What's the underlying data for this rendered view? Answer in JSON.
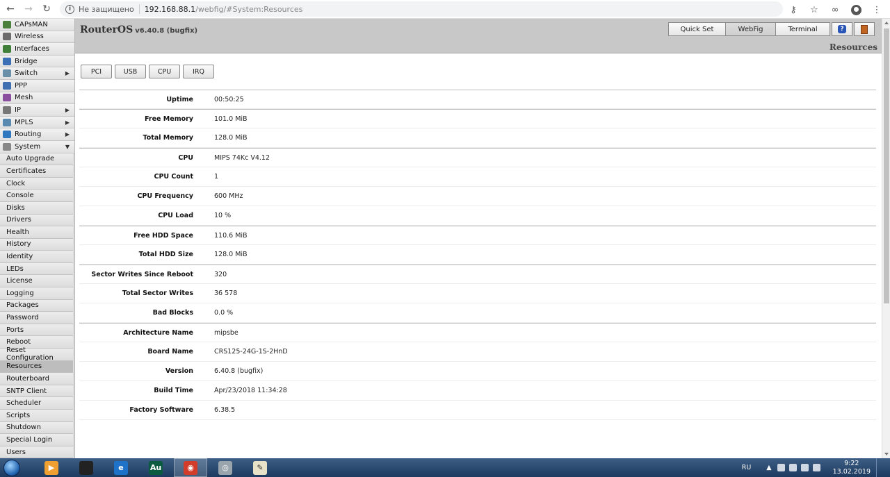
{
  "browser": {
    "security_label": "Не защищено",
    "url_host": "192.168.88.1",
    "url_path": "/webfig/#System:Resources"
  },
  "sidebar": {
    "items": [
      {
        "label": "CAPsMAN",
        "icon": "capsman-icon",
        "has_submenu": false
      },
      {
        "label": "Wireless",
        "icon": "wireless-icon",
        "has_submenu": false
      },
      {
        "label": "Interfaces",
        "icon": "interfaces-icon",
        "has_submenu": false
      },
      {
        "label": "Bridge",
        "icon": "bridge-icon",
        "has_submenu": false
      },
      {
        "label": "Switch",
        "icon": "switch-icon",
        "has_submenu": true
      },
      {
        "label": "PPP",
        "icon": "ppp-icon",
        "has_submenu": false
      },
      {
        "label": "Mesh",
        "icon": "mesh-icon",
        "has_submenu": false
      },
      {
        "label": "IP",
        "icon": "ip-icon",
        "has_submenu": true
      },
      {
        "label": "MPLS",
        "icon": "mpls-icon",
        "has_submenu": true
      },
      {
        "label": "Routing",
        "icon": "routing-icon",
        "has_submenu": true
      },
      {
        "label": "System",
        "icon": "system-gear-icon",
        "has_submenu": true,
        "expanded": true
      }
    ],
    "system_submenu": [
      "Auto Upgrade",
      "Certificates",
      "Clock",
      "Console",
      "Disks",
      "Drivers",
      "Health",
      "History",
      "Identity",
      "LEDs",
      "License",
      "Logging",
      "Packages",
      "Password",
      "Ports",
      "Reboot",
      "Reset Configuration",
      "Resources",
      "Routerboard",
      "SNTP Client",
      "Scheduler",
      "Scripts",
      "Shutdown",
      "Special Login",
      "Users"
    ],
    "active_submenu": "Resources"
  },
  "header": {
    "brand": "RouterOS",
    "version": "v6.40.8 (bugfix)",
    "buttons": {
      "quick_set": "Quick Set",
      "webfig": "WebFig",
      "terminal": "Terminal"
    },
    "active_button": "WebFig",
    "page_title": "Resources"
  },
  "tabs": [
    "PCI",
    "USB",
    "CPU",
    "IRQ"
  ],
  "properties": [
    {
      "label": "Uptime",
      "value": "00:50:25",
      "group_start": true
    },
    {
      "label": "Free Memory",
      "value": "101.0 MiB",
      "group_start": true
    },
    {
      "label": "Total Memory",
      "value": "128.0 MiB",
      "group_start": false
    },
    {
      "label": "CPU",
      "value": "MIPS 74Kc V4.12",
      "group_start": true
    },
    {
      "label": "CPU Count",
      "value": "1",
      "group_start": false
    },
    {
      "label": "CPU Frequency",
      "value": "600 MHz",
      "group_start": false
    },
    {
      "label": "CPU Load",
      "value": "10 %",
      "group_start": false
    },
    {
      "label": "Free HDD Space",
      "value": "110.6 MiB",
      "group_start": true
    },
    {
      "label": "Total HDD Size",
      "value": "128.0 MiB",
      "group_start": false
    },
    {
      "label": "Sector Writes Since Reboot",
      "value": "320",
      "group_start": true
    },
    {
      "label": "Total Sector Writes",
      "value": "36 578",
      "group_start": false
    },
    {
      "label": "Bad Blocks",
      "value": "0.0 %",
      "group_start": false
    },
    {
      "label": "Architecture Name",
      "value": "mipsbe",
      "group_start": true
    },
    {
      "label": "Board Name",
      "value": "CRS125-24G-1S-2HnD",
      "group_start": false
    },
    {
      "label": "Version",
      "value": "6.40.8 (bugfix)",
      "group_start": false
    },
    {
      "label": "Build Time",
      "value": "Apr/23/2018 11:34:28",
      "group_start": false
    },
    {
      "label": "Factory Software",
      "value": "6.38.5",
      "group_start": false
    }
  ],
  "taskbar": {
    "apps": [
      {
        "name": "media-player-icon",
        "color": "#f0a030",
        "glyph": "▶"
      },
      {
        "name": "terminal-icon",
        "color": "#222222",
        "glyph": ""
      },
      {
        "name": "internet-explorer-icon",
        "color": "#1e73c8",
        "glyph": "e"
      },
      {
        "name": "audition-icon",
        "color": "#0a5b3f",
        "glyph": "Au"
      },
      {
        "name": "chrome-icon",
        "color": "#d23c2a",
        "glyph": "◉"
      },
      {
        "name": "disc-icon",
        "color": "#9aa4ad",
        "glyph": "◎"
      },
      {
        "name": "notepad-icon",
        "color": "#e8e2c8",
        "glyph": "✎"
      }
    ],
    "language": "RU",
    "time": "9:22",
    "date": "13.02.2019"
  }
}
